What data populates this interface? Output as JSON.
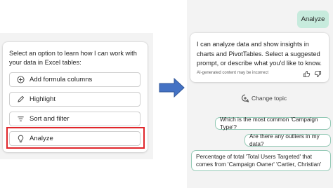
{
  "left_panel": {
    "prompt": "Select an option to learn how I can work with your data in Excel tables:",
    "options": [
      {
        "label": "Add formula columns",
        "icon": "plus-circle-icon"
      },
      {
        "label": "Highlight",
        "icon": "pencil-icon"
      },
      {
        "label": "Sort and filter",
        "icon": "filter-lines-icon"
      },
      {
        "label": "Analyze",
        "icon": "lightbulb-icon"
      }
    ],
    "highlight_color": "#e0262b"
  },
  "arrow": {
    "color": "#3d6fc0",
    "icon": "right-arrow-icon"
  },
  "right_panel": {
    "user_message": "Analyze",
    "ai_response": "I can analyze data and show insights in charts and PivotTables. Select a suggested prompt, or describe what you'd like to know.",
    "ai_disclaimer": "AI-generated content may be incorrect",
    "change_topic": "Change topic",
    "suggestions": [
      "Which is the most common 'Campaign Type'?",
      "Are there any outliers in my data?",
      "Percentage of total 'Total Users Targeted' that comes from 'Campaign Owner' 'Cartier, Christian'"
    ],
    "accent_color": "#c7ebdd"
  }
}
